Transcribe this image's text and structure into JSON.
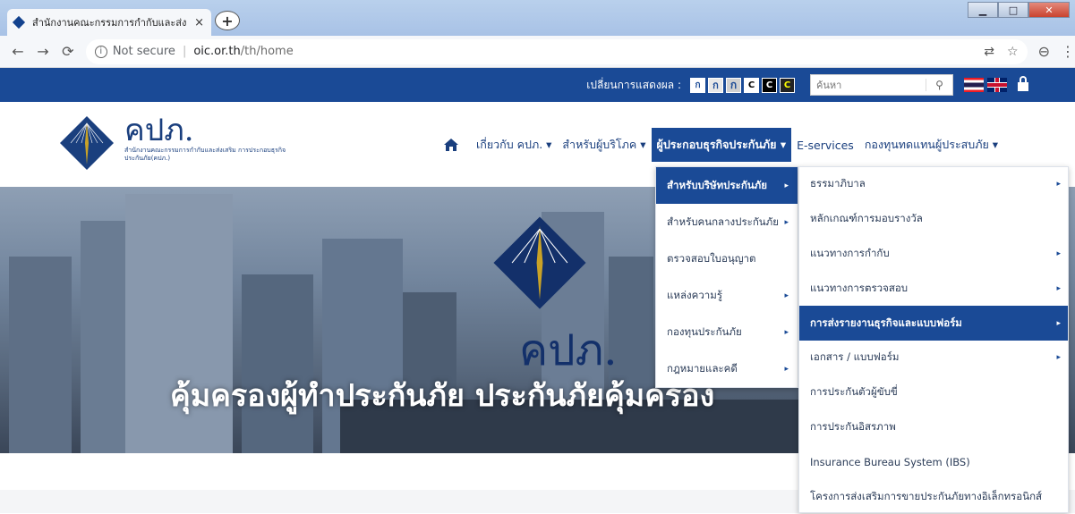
{
  "browser": {
    "tab_title": "สำนักงานคณะกรรมการกำกับและส่ง",
    "tab_close": "×",
    "new_tab": "+",
    "not_secure": "Not secure",
    "url_host": "oic.or.th",
    "url_path": "/th/home",
    "window_controls": [
      "▁",
      "□",
      "✕"
    ]
  },
  "topbar": {
    "display_label": "เปลี่ยนการแสดงผล :",
    "font_buttons": [
      "ก",
      "ก",
      "ก"
    ],
    "contrast_buttons": [
      "C",
      "C",
      "C"
    ],
    "search_placeholder": "ค้นหา",
    "search_icon": "search-icon"
  },
  "header": {
    "logo_text": "คปภ.",
    "logo_subtitle": "สำนักงานคณะกรรมการกำกับและส่งเสริม การประกอบธุรกิจประกันภัย(คปภ.)"
  },
  "nav": {
    "items": [
      {
        "label": "เกี่ยวกับ คปภ. ▾"
      },
      {
        "label": "สำหรับผู้บริโภค ▾"
      },
      {
        "label": "ผู้ประกอบธุรกิจประกันภัย ▾"
      },
      {
        "label": "E-services"
      },
      {
        "label": "กองทุนทดแทนผู้ประสบภัย ▾"
      }
    ]
  },
  "banner": {
    "logo_text": "คปภ.",
    "tagline": "คุ้มครองผู้ทำประกันภัย  ประกันภัยคุ้มครอง"
  },
  "dropdown": {
    "items": [
      {
        "label": "สำหรับบริษัทประกันภัย",
        "arrow": "▸"
      },
      {
        "label": "สำหรับคนกลางประกันภัย",
        "arrow": "▸"
      },
      {
        "label": "ตรวจสอบใบอนุญาต",
        "arrow": ""
      },
      {
        "label": "แหล่งความรู้",
        "arrow": "▸"
      },
      {
        "label": "กองทุนประกันภัย",
        "arrow": "▸"
      },
      {
        "label": "กฎหมายและคดี",
        "arrow": "▸"
      }
    ]
  },
  "submenu": {
    "items": [
      {
        "label": "ธรรมาภิบาล",
        "arrow": "▸"
      },
      {
        "label": "หลักเกณฑ์การมอบรางวัล",
        "arrow": ""
      },
      {
        "label": "แนวทางการกำกับ",
        "arrow": "▸"
      },
      {
        "label": "แนวทางการตรวจสอบ",
        "arrow": "▸"
      },
      {
        "label": "การส่งรายงานธุรกิจและแบบฟอร์ม",
        "arrow": "▸"
      },
      {
        "label": "เอกสาร / แบบฟอร์ม",
        "arrow": "▸"
      },
      {
        "label": "การประกันตัวผู้ขับขี่",
        "arrow": ""
      },
      {
        "label": "การประกันอิสรภาพ",
        "arrow": ""
      },
      {
        "label": "Insurance Bureau System (IBS)",
        "arrow": ""
      },
      {
        "label": "โครงการส่งเสริมการขายประกันภัยทางอิเล็กทรอนิกส์",
        "arrow": ""
      }
    ]
  },
  "colors": {
    "brand_blue": "#1a4a96",
    "logo_navy": "#1a3f7e",
    "logo_gold": "#c9a227"
  }
}
